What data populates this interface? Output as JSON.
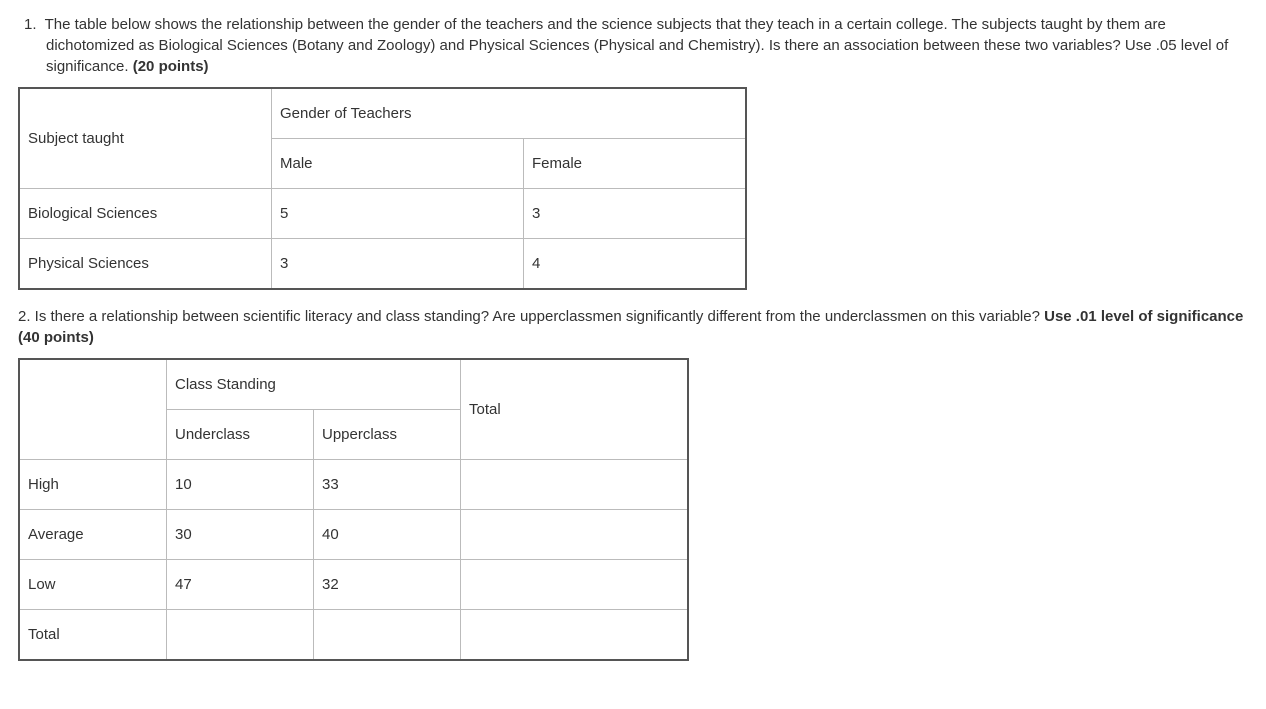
{
  "q1": {
    "number": "1.",
    "text_part1": "The table below shows the relationship between the gender of the teachers and the science subjects that they teach in a certain college. The subjects taught by them are dichotomized as Biological Sciences (Botany and Zoology) and Physical Sciences (Physical and Chemistry). Is there an association between these two variables? Use .05 level of significance. ",
    "points": "(20 points)",
    "table": {
      "row_header_title": "Subject taught",
      "col_group_title": "Gender of Teachers",
      "col_headers": [
        "Male",
        "Female"
      ],
      "rows": [
        {
          "label": "Biological Sciences",
          "values": [
            "5",
            "3"
          ]
        },
        {
          "label": "Physical Sciences",
          "values": [
            "3",
            "4"
          ]
        }
      ]
    }
  },
  "q2": {
    "text_part1": "2. Is there a relationship between scientific literacy and class standing? Are upperclassmen significantly different from the underclassmen on this variable? ",
    "sig_text": "Use .01 level of significance",
    "points": " (40 points)",
    "table": {
      "col_group_title": "Class Standing",
      "total_label": "Total",
      "col_headers": [
        "Underclass",
        "Upperclass"
      ],
      "rows": [
        {
          "label": "High",
          "values": [
            "10",
            "33"
          ]
        },
        {
          "label": "Average",
          "values": [
            "30",
            "40"
          ]
        },
        {
          "label": "Low",
          "values": [
            "47",
            "32"
          ]
        }
      ],
      "total_row_label": "Total"
    }
  },
  "chart_data": [
    {
      "type": "table",
      "title": "Gender of Teachers vs Subject taught",
      "row_labels": [
        "Biological Sciences",
        "Physical Sciences"
      ],
      "col_labels": [
        "Male",
        "Female"
      ],
      "values": [
        [
          5,
          3
        ],
        [
          3,
          4
        ]
      ]
    },
    {
      "type": "table",
      "title": "Class Standing vs Scientific Literacy",
      "row_labels": [
        "High",
        "Average",
        "Low"
      ],
      "col_labels": [
        "Underclass",
        "Upperclass"
      ],
      "values": [
        [
          10,
          33
        ],
        [
          30,
          40
        ],
        [
          47,
          32
        ]
      ]
    }
  ]
}
